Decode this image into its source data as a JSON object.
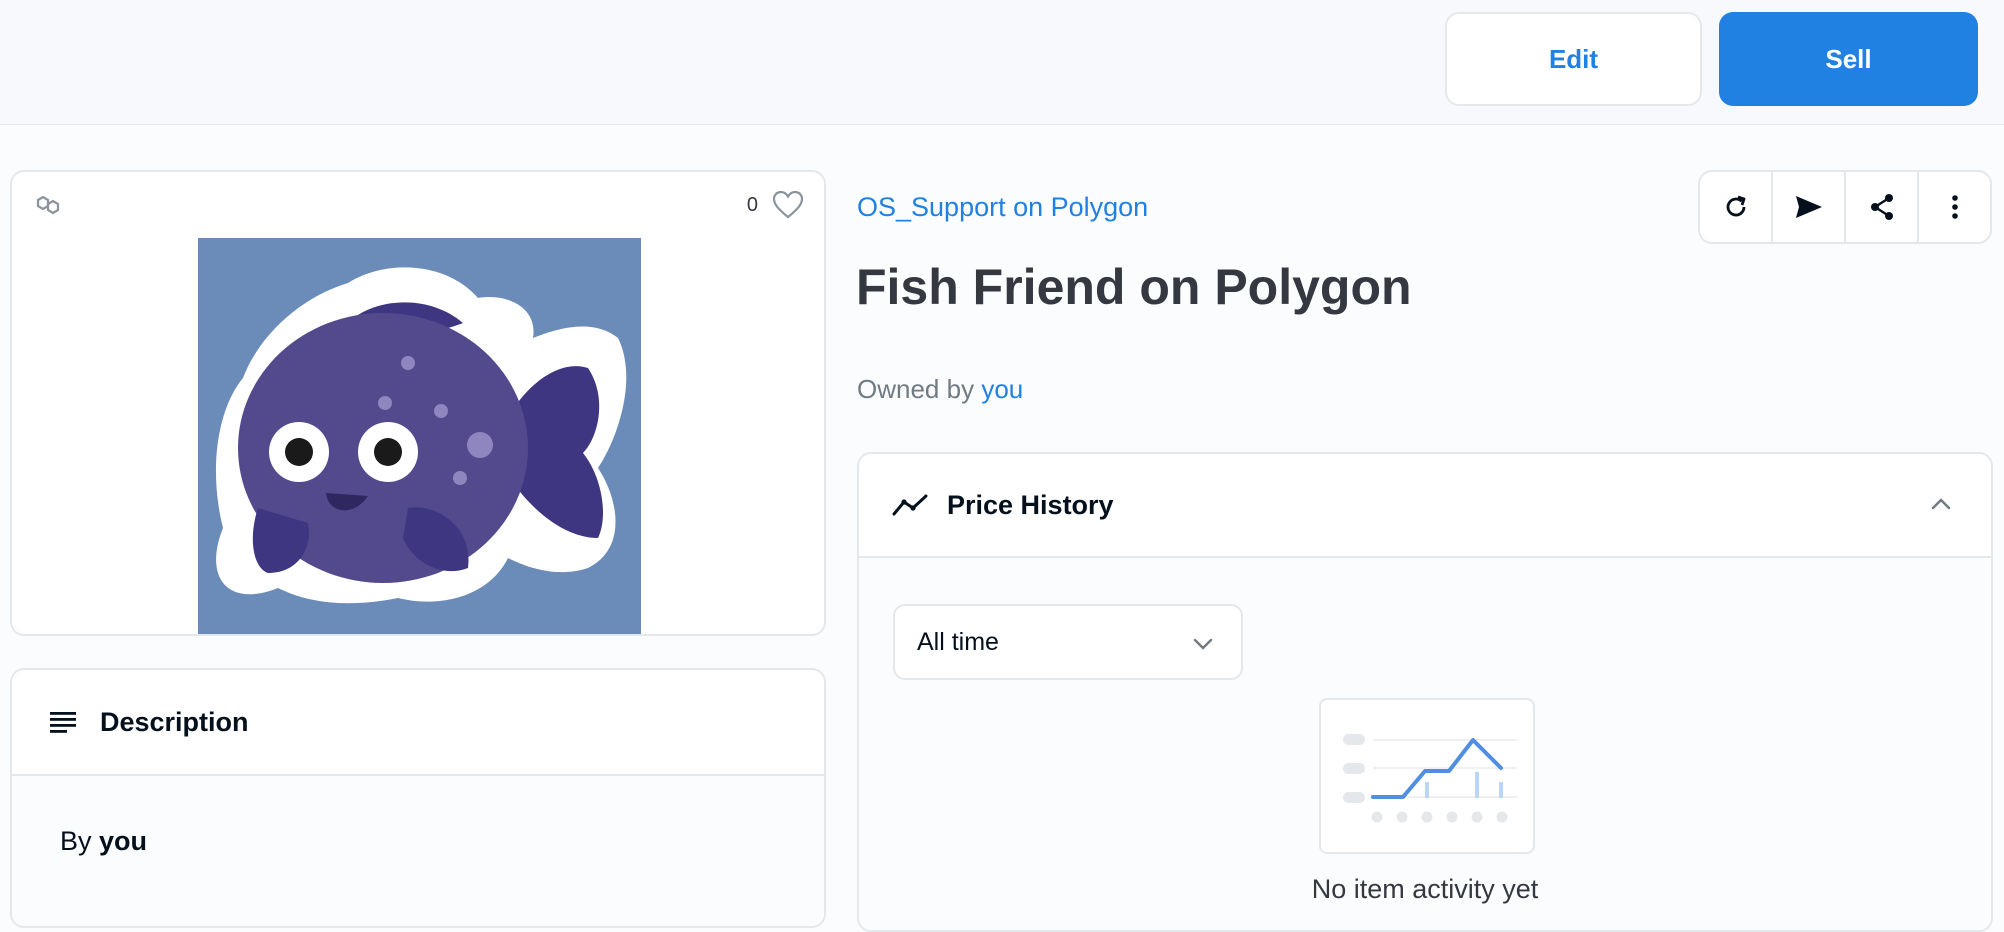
{
  "header": {
    "edit_label": "Edit",
    "sell_label": "Sell"
  },
  "media": {
    "favorite_count": "0",
    "chain_icon": "polygon-chain-icon",
    "favorite_icon": "heart-icon"
  },
  "description": {
    "title": "Description",
    "by_prefix": "By",
    "author": "you"
  },
  "item": {
    "collection": "OS_Support on Polygon",
    "title": "Fish Friend on Polygon",
    "owned_by_prefix": "Owned by",
    "owner": "you"
  },
  "actions": [
    "refresh-icon",
    "transfer-icon",
    "share-icon",
    "more-icon"
  ],
  "price_history": {
    "title": "Price History",
    "range_selected": "All time",
    "empty_message": "No item activity yet"
  },
  "colors": {
    "accent": "#2081e2",
    "image_bg": "#6b8cb8",
    "fish_body": "#534a8e"
  }
}
